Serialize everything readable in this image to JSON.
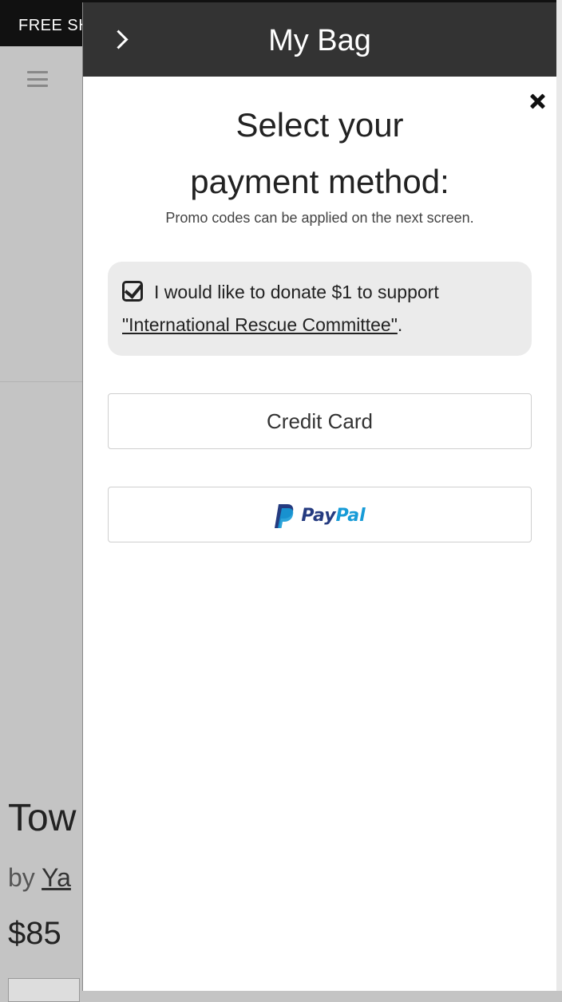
{
  "background": {
    "banner_text": "FREE SH",
    "product_title": "Tow",
    "by_prefix": "by ",
    "artist_link": "Ya",
    "price": "$85"
  },
  "drawer": {
    "header_title": "My Bag",
    "heading_line1": "Select your",
    "heading_line2": "payment method:",
    "promo_note": "Promo codes can be applied on the next screen.",
    "donate_text": "I would like to donate $1 to support",
    "donate_link": "\"International Rescue Committee\"",
    "donate_suffix": ".",
    "donate_checked": true,
    "credit_card_label": "Credit Card",
    "paypal_label_part1": "Pay",
    "paypal_label_part2": "Pal"
  },
  "colors": {
    "header_bg": "#333333",
    "paypal_dark": "#253b80",
    "paypal_light": "#179bd7"
  }
}
